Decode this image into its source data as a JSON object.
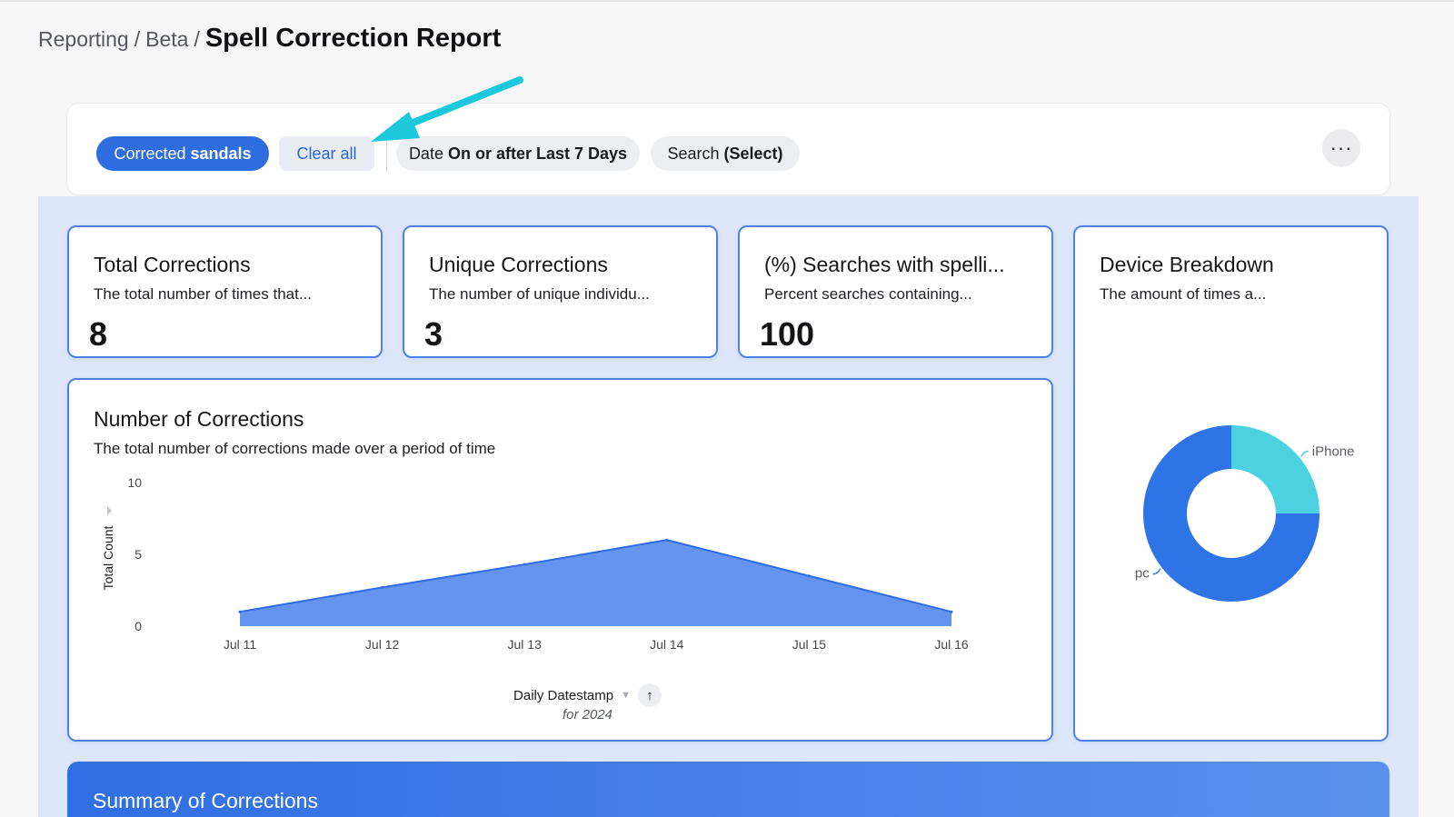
{
  "breadcrumb": {
    "items": [
      "Reporting",
      "Beta"
    ],
    "separator": "/",
    "title": "Spell Correction Report"
  },
  "filters": {
    "active_chip": {
      "key": "Corrected",
      "value": "sandals"
    },
    "clear_label": "Clear all",
    "date_chip": {
      "key": "Date",
      "value": "On or after Last 7 Days"
    },
    "search_chip": {
      "key": "Search",
      "value": "(Select)"
    },
    "more_label": "···"
  },
  "kpis": [
    {
      "title": "Total Corrections",
      "description": "The total number of times that...",
      "value": "8"
    },
    {
      "title": "Unique Corrections",
      "description": "The number of unique individu...",
      "value": "3"
    },
    {
      "title": "(%) Searches with spelli...",
      "description": "Percent searches containing...",
      "value": "100"
    }
  ],
  "corrections_chart": {
    "title": "Number of Corrections",
    "description": "The total number of corrections made over a period of time",
    "x_axis_title": "Daily Datestamp",
    "x_axis_subtitle": "for 2024",
    "sort_icon": "↑",
    "caret_icon": "▼"
  },
  "device_chart": {
    "title": "Device Breakdown",
    "description": "The amount of times a..."
  },
  "summary": {
    "title": "Summary of Corrections"
  },
  "colors": {
    "accent": "#2e6ddf",
    "area_fill": "#6593f0",
    "area_line": "#2f6be3",
    "donut_pc": "#2f74e6",
    "donut_iphone": "#4bd1e0",
    "annotation_arrow": "#1ec8dc"
  },
  "chart_data": [
    {
      "type": "area",
      "title": "Number of Corrections",
      "xlabel": "Daily Datestamp",
      "ylabel": "Total Count",
      "categories": [
        "Jul 11",
        "Jul 12",
        "Jul 13",
        "Jul 14",
        "Jul 15",
        "Jul 16"
      ],
      "values": [
        1,
        2.7,
        4.3,
        6,
        3.5,
        1
      ],
      "yticks": [
        0,
        5,
        10
      ],
      "ylim": [
        0,
        10
      ],
      "grid": false
    },
    {
      "type": "pie",
      "title": "Device Breakdown",
      "series": [
        {
          "name": "pc",
          "value": 75
        },
        {
          "name": "iPhone",
          "value": 25
        }
      ],
      "donut": true
    }
  ]
}
